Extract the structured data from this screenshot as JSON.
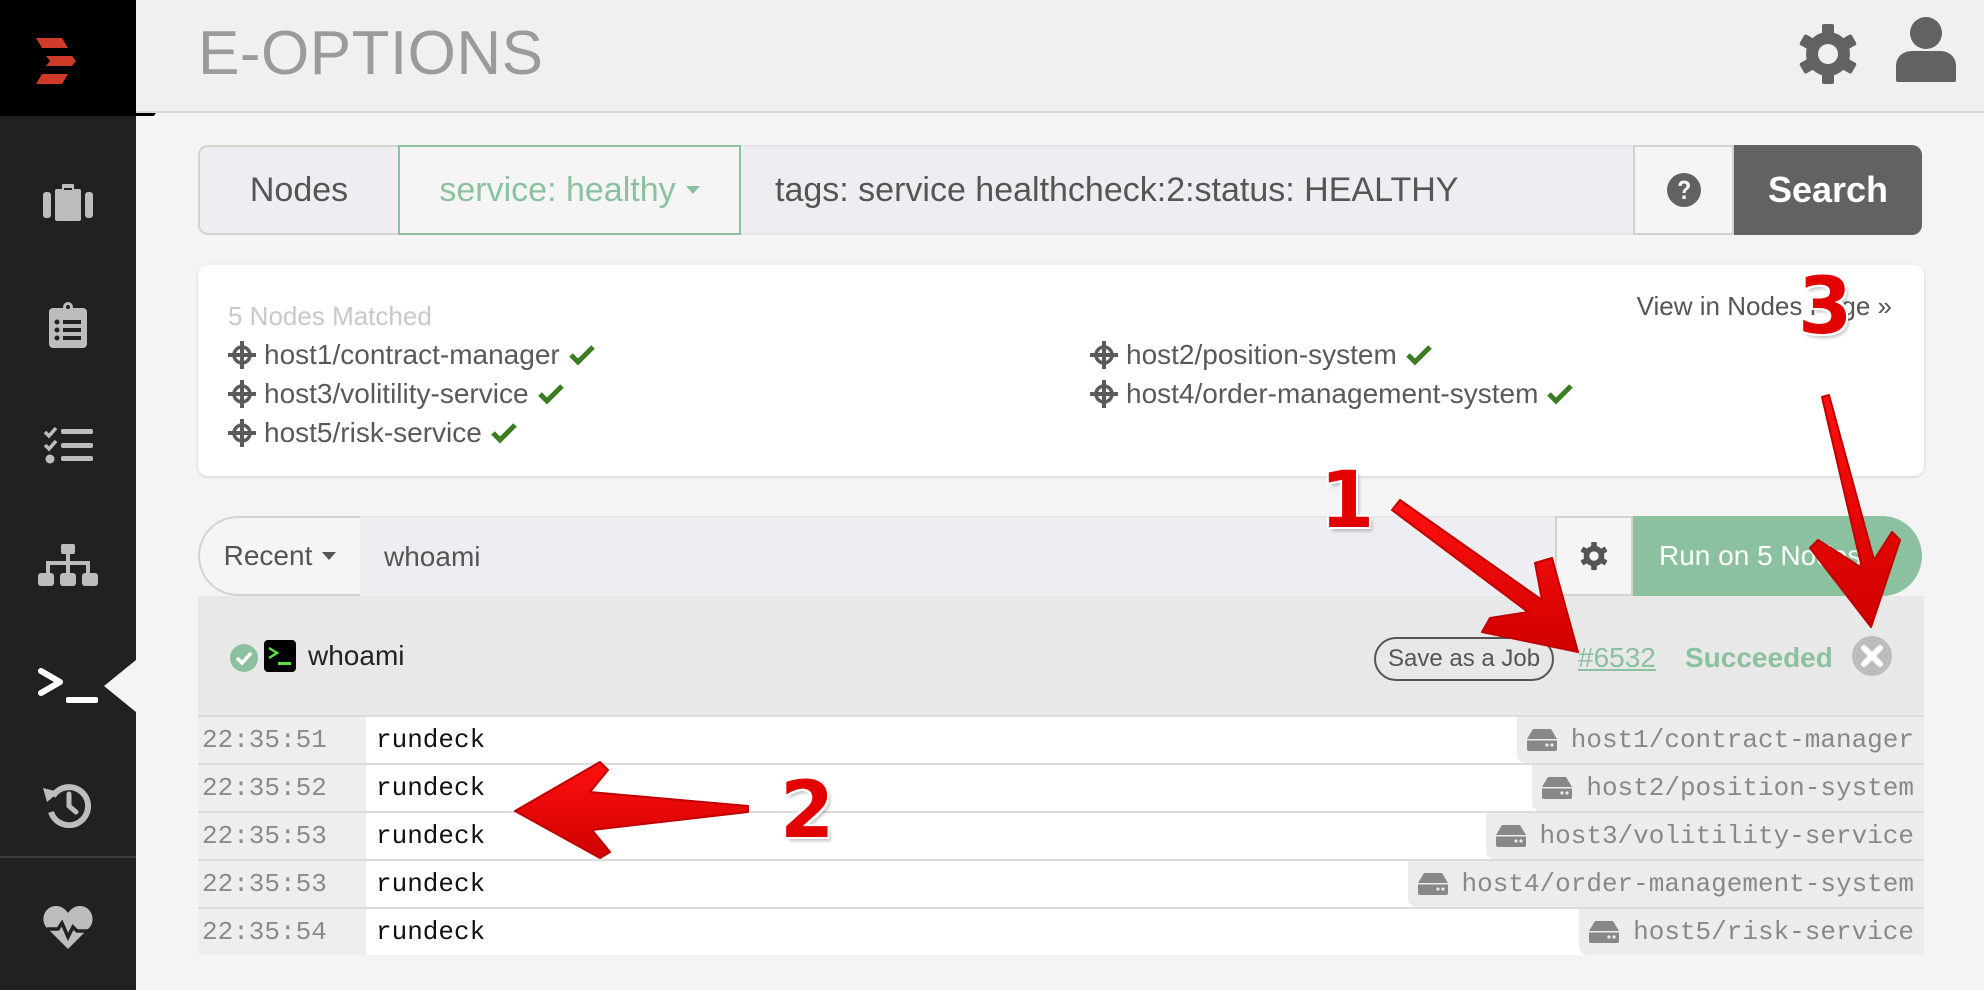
{
  "header": {
    "project_title": "E-OPTIONS"
  },
  "sidebar": {
    "items": [
      {
        "name": "jobs",
        "icon": "briefcase-icon"
      },
      {
        "name": "activity",
        "icon": "clipboard-icon"
      },
      {
        "name": "jobs-list",
        "icon": "task-list-icon"
      },
      {
        "name": "nodes",
        "icon": "sitemap-icon"
      },
      {
        "name": "commands",
        "icon": "terminal-icon",
        "active": true
      },
      {
        "name": "history",
        "icon": "history-icon"
      },
      {
        "name": "health",
        "icon": "heartbeat-icon"
      }
    ]
  },
  "search": {
    "nodes_label": "Nodes",
    "filter_label": "service: healthy",
    "query": "tags: service healthcheck:2:status: HEALTHY",
    "help_icon": "question-circle-icon",
    "search_label": "Search"
  },
  "matched": {
    "count_label": "5 Nodes Matched",
    "view_link": "View in Nodes Page »",
    "nodes": [
      "host1/contract-manager",
      "host2/position-system",
      "host3/volitility-service",
      "host4/order-management-system",
      "host5/risk-service"
    ]
  },
  "command": {
    "recent_label": "Recent",
    "value": "whoami",
    "run_label": "Run on 5 Nodes"
  },
  "result": {
    "title": "whoami",
    "save_label": "Save as a Job",
    "execution_id": "#6532",
    "status": "Succeeded",
    "rows": [
      {
        "time": "22:35:51",
        "text": "rundeck",
        "node": "host1/contract-manager"
      },
      {
        "time": "22:35:52",
        "text": "rundeck",
        "node": "host2/position-system"
      },
      {
        "time": "22:35:53",
        "text": "rundeck",
        "node": "host3/volitility-service"
      },
      {
        "time": "22:35:53",
        "text": "rundeck",
        "node": "host4/order-management-system"
      },
      {
        "time": "22:35:54",
        "text": "rundeck",
        "node": "host5/risk-service"
      }
    ]
  },
  "annotations": {
    "one": "1",
    "two": "2",
    "three": "3"
  },
  "colors": {
    "accent_green": "#8cc19f",
    "check_green": "#3b7d23",
    "annotation_red": "#e30000",
    "search_button": "#626262",
    "sidebar_bg": "#212121"
  }
}
